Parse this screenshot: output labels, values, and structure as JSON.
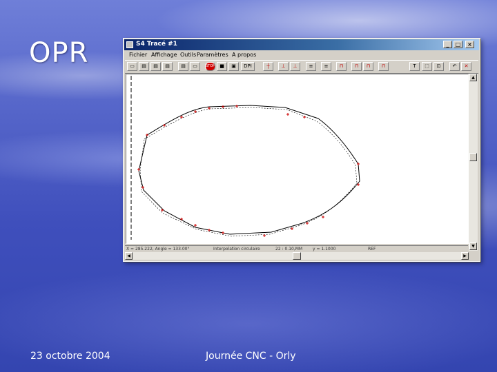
{
  "slide": {
    "title": "OPR",
    "footer_date": "23 octobre 2004",
    "footer_center": "Journée CNC - Orly"
  },
  "window": {
    "title": "S4 Tracé #1",
    "buttons": {
      "minimize": "_",
      "maximize": "□",
      "close": "×"
    },
    "menu": [
      "Fichier",
      "Affichage",
      "Outils",
      "Paramètres",
      "A propos"
    ],
    "toolbar_labels": [
      "DPI",
      "STOP"
    ],
    "status": [
      "X = 285.222, Angle = 133.00°",
      "Interpolation circulaire",
      "22 : 0.10,MM",
      "y = 1.1000",
      "REF"
    ]
  },
  "colors": {
    "accent": "#0a246a",
    "trace": "#000000",
    "marker": "#cc0000"
  },
  "icons": [
    "folder-icon",
    "save-icon",
    "stop-icon",
    "zoom-icon",
    "text-icon"
  ]
}
